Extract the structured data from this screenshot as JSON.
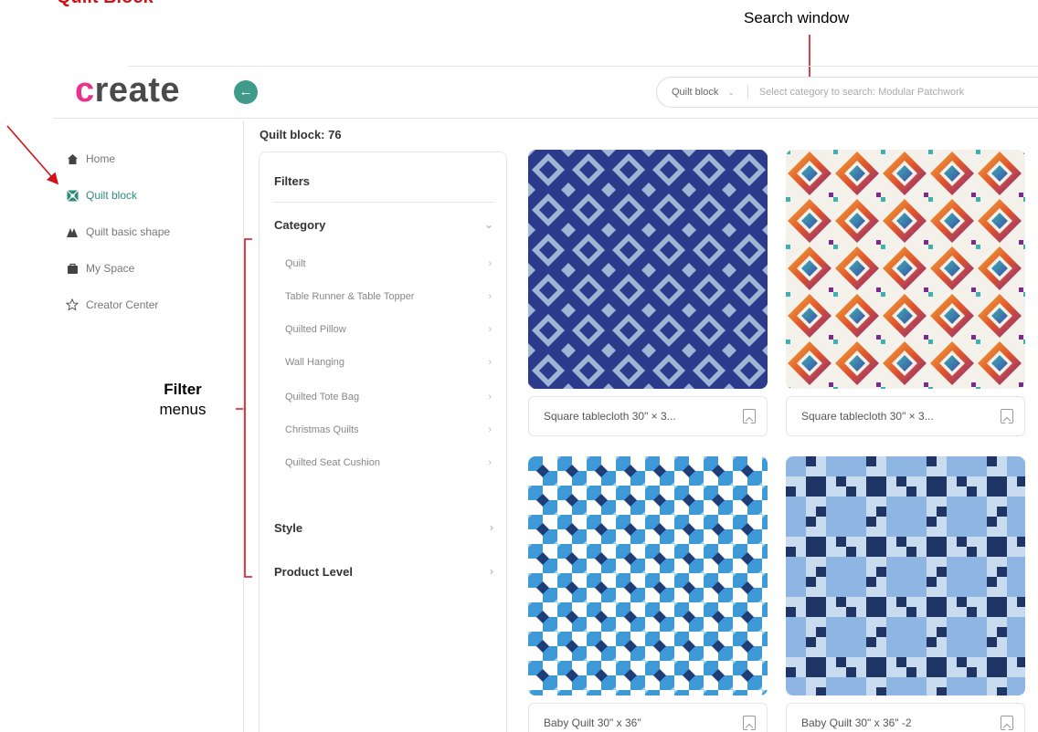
{
  "annotations": {
    "title": "Quilt Block",
    "search_window": "Search window",
    "filter_bold": "Filter",
    "filter_rest": "menus"
  },
  "header": {
    "logo": "create",
    "search": {
      "category": "Quilt block",
      "placeholder": "Select category to search: Modular Patchwork"
    }
  },
  "sidebar": {
    "items": [
      {
        "label": "Home",
        "icon": "home-icon"
      },
      {
        "label": "Quilt block",
        "icon": "quilt-block-icon"
      },
      {
        "label": "Quilt basic shape",
        "icon": "basic-shape-icon"
      },
      {
        "label": "My Space",
        "icon": "my-space-icon"
      },
      {
        "label": "Creator Center",
        "icon": "creator-center-icon"
      }
    ]
  },
  "main": {
    "count_title": "Quilt block: 76",
    "filters": {
      "heading": "Filters",
      "category": {
        "label": "Category",
        "items": [
          "Quilt",
          "Table Runner & Table Topper",
          "Quilted Pillow",
          "Wall Hanging",
          "Quilted Tote Bag",
          "Christmas Quilts",
          "Quilted Seat Cushion"
        ]
      },
      "style": "Style",
      "product_level": "Product Level"
    },
    "cards": [
      {
        "title": "Square tablecloth 30\" × 3...",
        "pattern": "navy-stars"
      },
      {
        "title": "Square tablecloth 30\" × 3...",
        "pattern": "rainbow-diamonds"
      },
      {
        "title": "Baby Quilt 30\" x 36\"",
        "pattern": "blue-checker-stars"
      },
      {
        "title": "Baby Quilt 30\" x 36\" -2",
        "pattern": "blue-nine-patch"
      }
    ]
  },
  "colors": {
    "accent": "#2e8b7e",
    "annotation_red": "#d0131a",
    "navy": "#2b3a8a",
    "light_blue": "#9eb9d8"
  }
}
